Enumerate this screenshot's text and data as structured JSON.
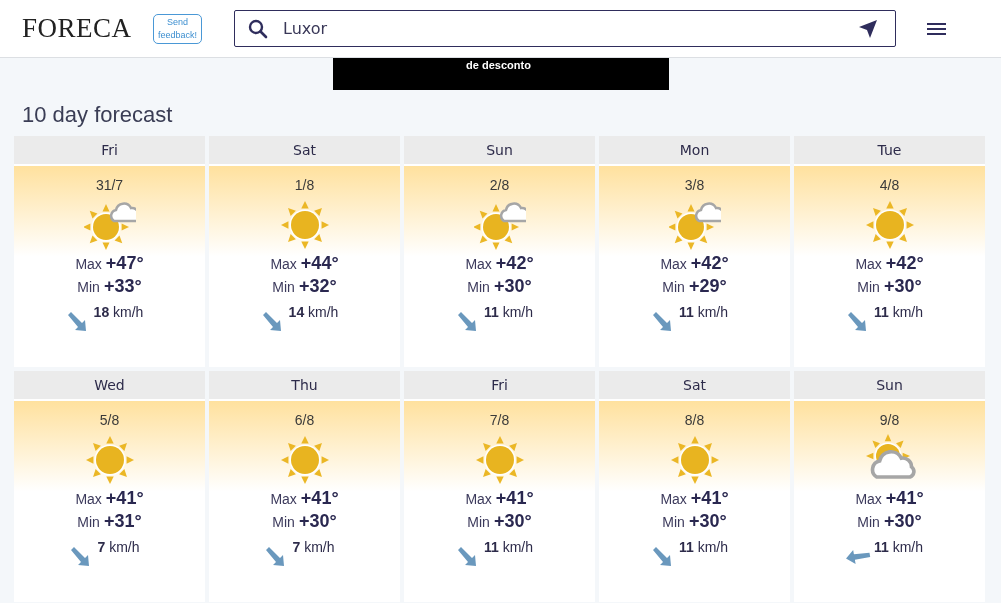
{
  "header": {
    "logo": "FORECA",
    "feedback": "Send feedback!",
    "search": {
      "value": "Luxor"
    }
  },
  "ad": {
    "text": "de desconto"
  },
  "title": "10 day forecast",
  "days": [
    {
      "day": "Fri",
      "date": "31/7",
      "kind": "suncloud",
      "max_label": "Max",
      "max": "+47°",
      "min_label": "Min",
      "min": "+33°",
      "wind": {
        "kind": "southeast",
        "speed": "18",
        "unit": "km/h"
      }
    },
    {
      "day": "Sat",
      "date": "1/8",
      "kind": "sunny",
      "max_label": "Max",
      "max": "+44°",
      "min_label": "Min",
      "min": "+32°",
      "wind": {
        "kind": "southeast",
        "speed": "14",
        "unit": "km/h"
      }
    },
    {
      "day": "Sun",
      "date": "2/8",
      "kind": "suncloud",
      "max_label": "Max",
      "max": "+42°",
      "min_label": "Min",
      "min": "+30°",
      "wind": {
        "kind": "southeast",
        "speed": "11",
        "unit": "km/h"
      }
    },
    {
      "day": "Mon",
      "date": "3/8",
      "kind": "suncloud",
      "max_label": "Max",
      "max": "+42°",
      "min_label": "Min",
      "min": "+29°",
      "wind": {
        "kind": "southeast",
        "speed": "11",
        "unit": "km/h"
      }
    },
    {
      "day": "Tue",
      "date": "4/8",
      "kind": "sunny",
      "max_label": "Max",
      "max": "+42°",
      "min_label": "Min",
      "min": "+30°",
      "wind": {
        "kind": "southeast",
        "speed": "11",
        "unit": "km/h"
      }
    },
    {
      "day": "Wed",
      "date": "5/8",
      "kind": "sunny",
      "max_label": "Max",
      "max": "+41°",
      "min_label": "Min",
      "min": "+31°",
      "wind": {
        "kind": "southeast",
        "speed": "7",
        "unit": "km/h"
      }
    },
    {
      "day": "Thu",
      "date": "6/8",
      "kind": "sunny",
      "max_label": "Max",
      "max": "+41°",
      "min_label": "Min",
      "min": "+30°",
      "wind": {
        "kind": "southeast",
        "speed": "7",
        "unit": "km/h"
      }
    },
    {
      "day": "Fri",
      "date": "7/8",
      "kind": "sunny",
      "max_label": "Max",
      "max": "+41°",
      "min_label": "Min",
      "min": "+30°",
      "wind": {
        "kind": "southeast",
        "speed": "11",
        "unit": "km/h"
      }
    },
    {
      "day": "Sat",
      "date": "8/8",
      "kind": "sunny",
      "max_label": "Max",
      "max": "+41°",
      "min_label": "Min",
      "min": "+30°",
      "wind": {
        "kind": "southeast",
        "speed": "11",
        "unit": "km/h"
      }
    },
    {
      "day": "Sun",
      "date": "9/8",
      "kind": "cloudy",
      "max_label": "Max",
      "max": "+41°",
      "min_label": "Min",
      "min": "+30°",
      "wind": {
        "kind": "west",
        "speed": "11",
        "unit": "km/h"
      }
    }
  ]
}
